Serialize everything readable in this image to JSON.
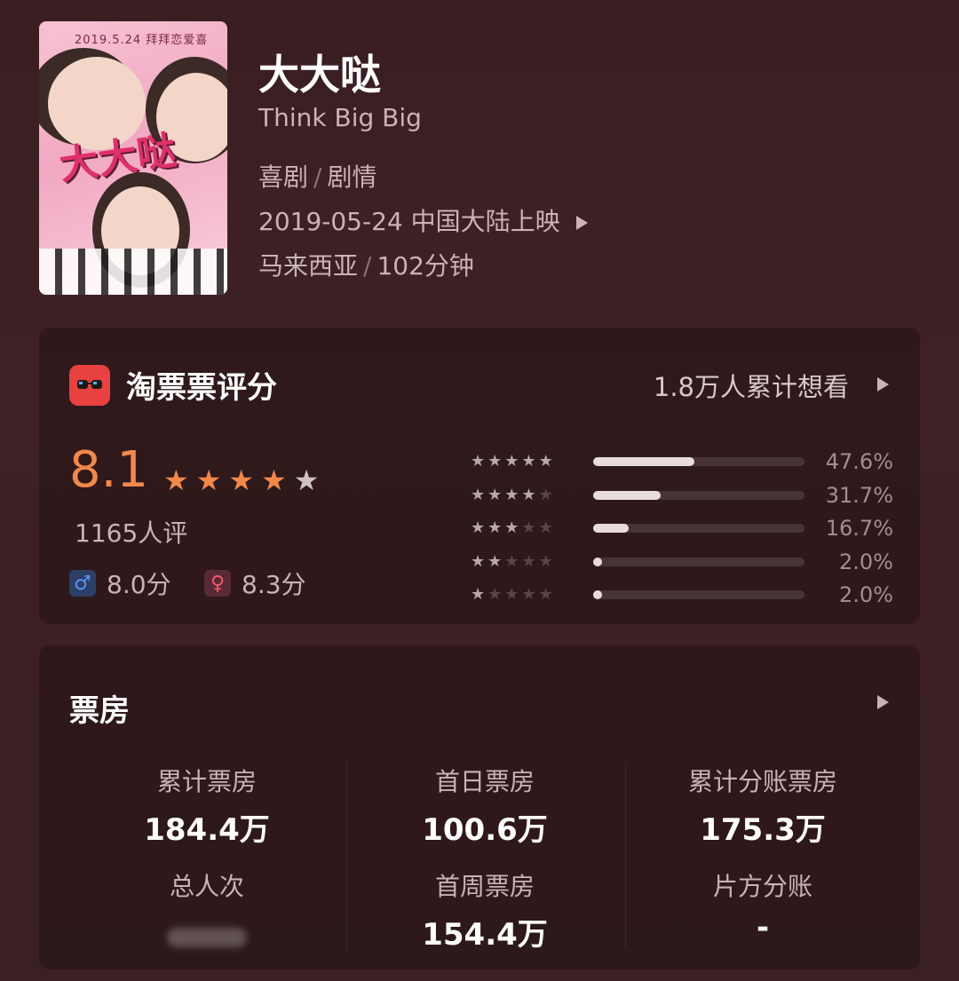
{
  "movie": {
    "title": "大大哒",
    "english_title": "Think Big Big",
    "genre_1": "喜剧",
    "genre_2": "剧情",
    "release": "2019-05-24 中国大陆上映",
    "country": "马来西亚",
    "duration": "102分钟",
    "poster": {
      "date_text": "2019.5.24 拜拜恋爱喜",
      "logo_text": "大大哒"
    }
  },
  "rating": {
    "brand": "淘票票评分",
    "want_text": "1.8万人累计想看",
    "score": "8.1",
    "stars_full": 4,
    "count_text": "1165人评",
    "male_score": "8.0分",
    "female_score": "8.3分",
    "distribution": [
      {
        "stars": 5,
        "percent": 47.6,
        "label": "47.6%"
      },
      {
        "stars": 4,
        "percent": 31.7,
        "label": "31.7%"
      },
      {
        "stars": 3,
        "percent": 16.7,
        "label": "16.7%"
      },
      {
        "stars": 2,
        "percent": 2.0,
        "label": "2.0%"
      },
      {
        "stars": 1,
        "percent": 2.0,
        "label": "2.0%"
      }
    ]
  },
  "box_office": {
    "title": "票房",
    "stats": [
      {
        "label": "累计票房",
        "value": "184.4万"
      },
      {
        "label": "首日票房",
        "value": "100.6万"
      },
      {
        "label": "累计分账票房",
        "value": "175.3万"
      },
      {
        "label": "总人次",
        "value": ""
      },
      {
        "label": "首周票房",
        "value": "154.4万"
      },
      {
        "label": "片方分账",
        "value": "-"
      }
    ]
  },
  "colors": {
    "accent": "#f2884a",
    "star_active": "#f2884a",
    "star_inactive": "#cfc3c4",
    "male": "#3b7be0",
    "female": "#e84a5f"
  }
}
